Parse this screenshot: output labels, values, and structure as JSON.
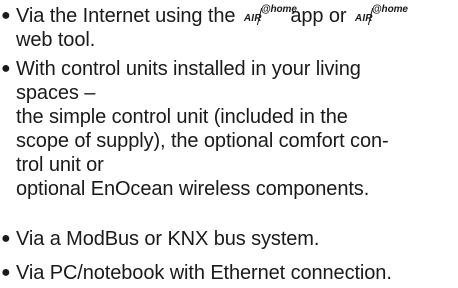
{
  "bullet": "●",
  "logo": {
    "air": "AIR",
    "home": "@home"
  },
  "items": [
    {
      "lines": [
        {
          "pre": "Via the Internet using the ",
          "mid": " app or "
        },
        {
          "text": "web tool."
        }
      ]
    },
    {
      "lines": [
        "With control units installed in your living",
        "spaces –",
        "the simple control unit (included in the",
        "scope of supply), the optional comfort con-",
        "trol unit or",
        "optional EnOcean wireless components."
      ]
    },
    {
      "lines": [
        "Via a ModBus or KNX bus system."
      ]
    },
    {
      "lines": [
        "Via PC/notebook with Ethernet connection."
      ]
    }
  ]
}
